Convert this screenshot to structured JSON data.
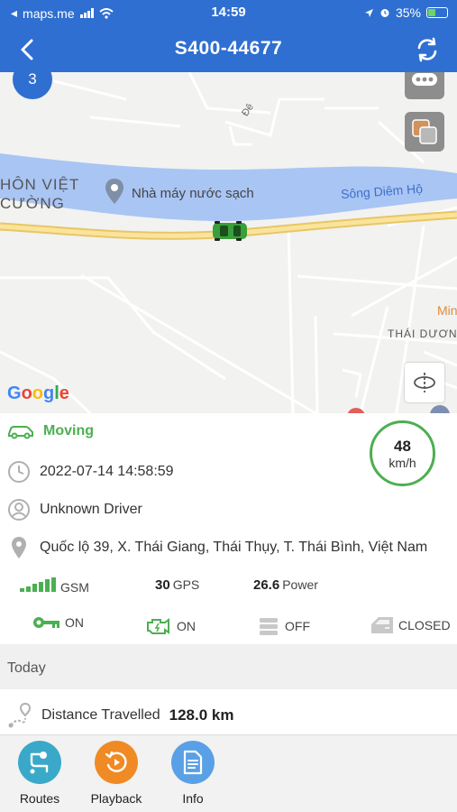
{
  "status_bar": {
    "carrier": "maps.me",
    "time": "14:59",
    "battery": "35%"
  },
  "header": {
    "title": "S400-44677"
  },
  "map": {
    "badge": "3",
    "labels": {
      "hon_viet": "HÔN VIỆT",
      "cuong": "CƯỜNG",
      "nha_may": "Nhà máy nước sạch",
      "song": "Sông Diêm Hộ",
      "de": "Đê",
      "thai_duong": "THÁI DƯƠNG",
      "min": "Min"
    },
    "google": "Google"
  },
  "vehicle": {
    "status": "Moving",
    "speed_value": "48",
    "speed_unit": "km/h",
    "datetime": "2022-07-14 14:58:59",
    "driver": "Unknown Driver",
    "address": "Quốc lộ 39, X. Thái Giang, Thái Thụy, T. Thái Bình, Việt Nam",
    "gsm_label": "GSM",
    "gps_value": "30",
    "gps_label": "GPS",
    "power_value": "26.6",
    "power_label": "Power",
    "ignition": "ON",
    "engine": "ON",
    "ac": "OFF",
    "door": "CLOSED"
  },
  "today": {
    "label": "Today",
    "distance_label": "Distance Travelled",
    "distance_value": "128.0 km"
  },
  "nav": {
    "routes": "Routes",
    "playback": "Playback",
    "info": "Info"
  },
  "colors": {
    "header_blue": "#2f6fd1",
    "moving_green": "#4caf50",
    "routes": "#3aa9c9",
    "playback": "#f08a24",
    "info": "#5aa0e6"
  }
}
